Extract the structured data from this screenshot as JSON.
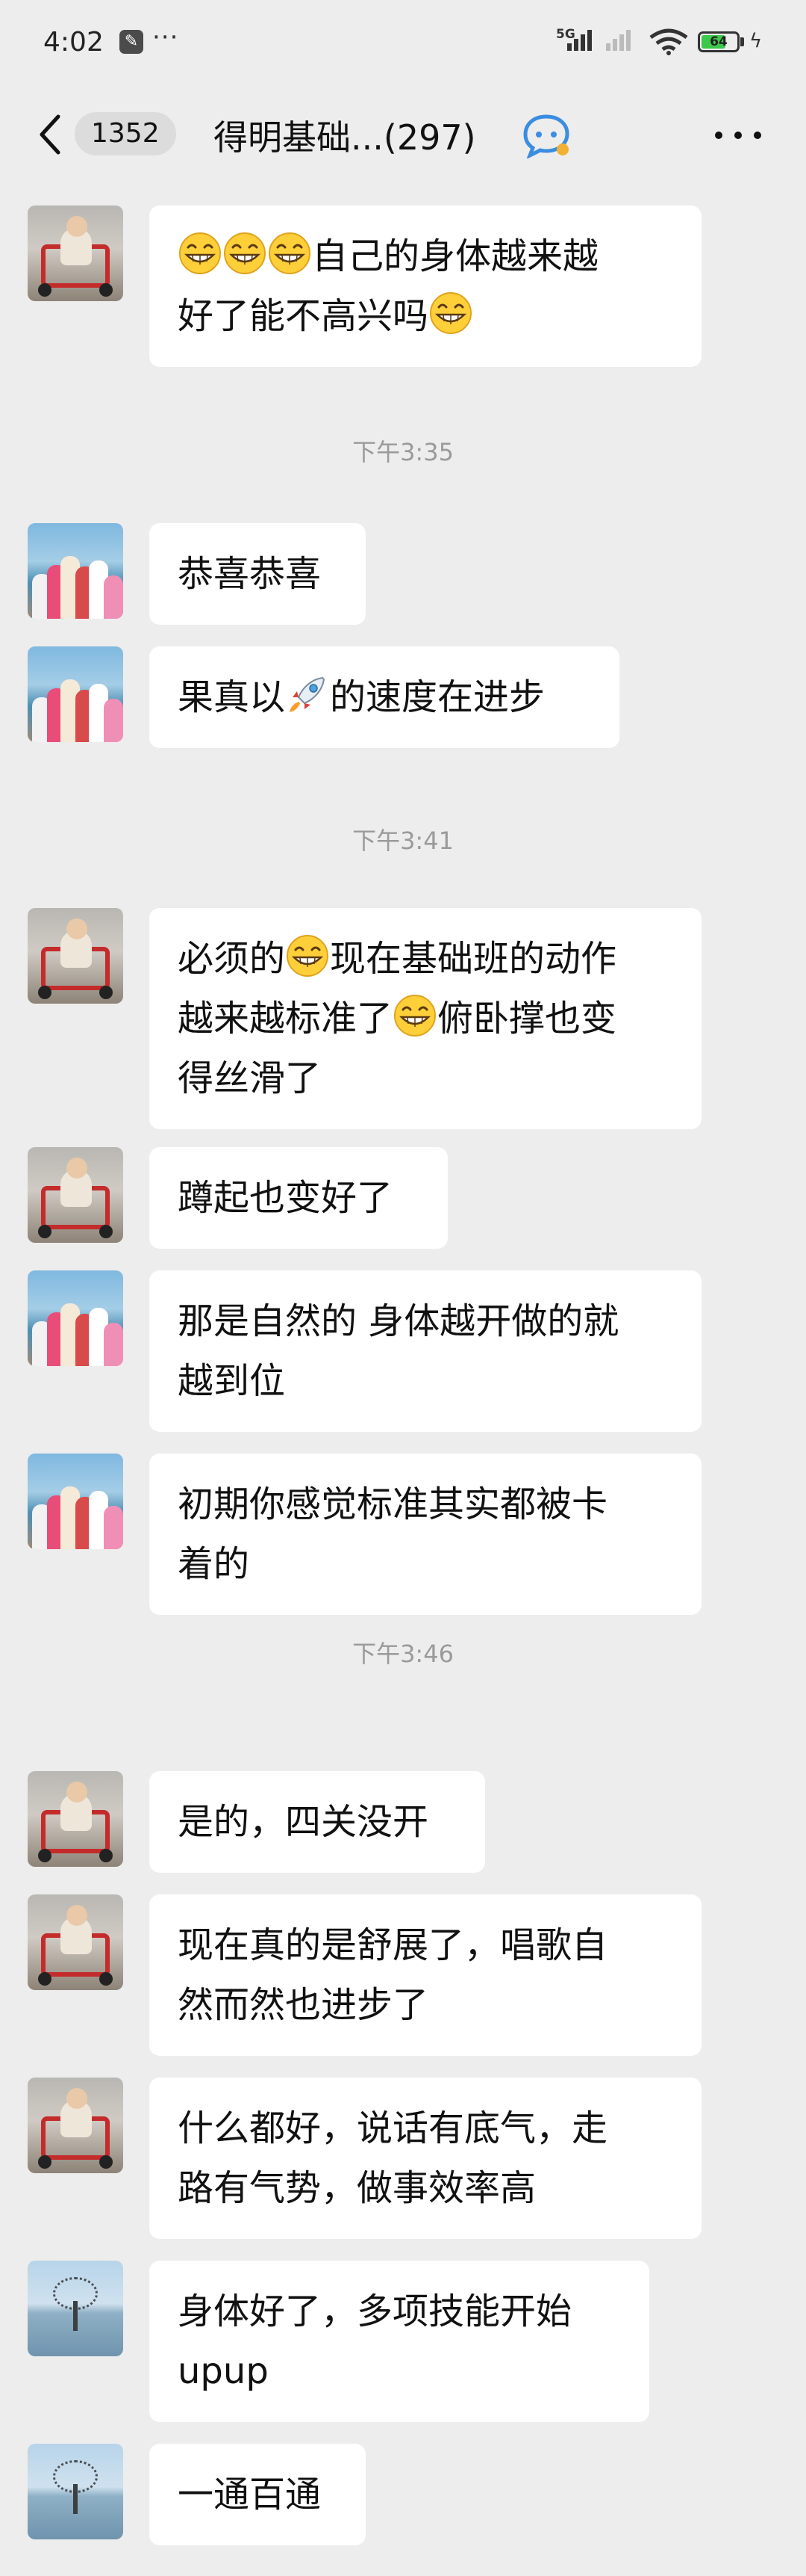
{
  "status_bar": {
    "time": "4:02",
    "more": "···",
    "network": "5G",
    "battery": "64"
  },
  "nav": {
    "unread_count": "1352",
    "title": "得明基础...(297)"
  },
  "messages": [
    {
      "type": "message",
      "sender": "baby",
      "parts": [
        "emoji:grin",
        "emoji:grin",
        "emoji:grin",
        "自己的身体越来越\n好了能不高兴吗",
        "emoji:grin"
      ]
    },
    {
      "type": "time",
      "text": "下午3:35"
    },
    {
      "type": "message",
      "sender": "group",
      "parts": [
        "恭喜恭喜"
      ]
    },
    {
      "type": "message",
      "sender": "group",
      "parts": [
        "果真以",
        "emoji:rocket",
        "的速度在进步"
      ]
    },
    {
      "type": "time",
      "text": "下午3:41"
    },
    {
      "type": "message",
      "sender": "baby",
      "parts": [
        "必须的",
        "emoji:grin",
        "现在基础班的动作\n越来越标准了",
        "emoji:grin",
        "俯卧撑也变\n得丝滑了"
      ]
    },
    {
      "type": "message",
      "sender": "baby",
      "parts": [
        "蹲起也变好了"
      ]
    },
    {
      "type": "message",
      "sender": "group",
      "parts": [
        "那是自然的 身体越开做的就\n越到位"
      ]
    },
    {
      "type": "message",
      "sender": "group",
      "parts": [
        "初期你感觉标准其实都被卡\n着的"
      ]
    },
    {
      "type": "time",
      "text": "下午3:46"
    },
    {
      "type": "message",
      "sender": "baby",
      "parts": [
        "是的，四关没开"
      ]
    },
    {
      "type": "message",
      "sender": "baby",
      "parts": [
        "现在真的是舒展了，唱歌自\n然而然也进步了"
      ]
    },
    {
      "type": "message",
      "sender": "baby",
      "parts": [
        "什么都好，说话有底气，走\n路有气势，做事效率高"
      ]
    },
    {
      "type": "message",
      "sender": "tree",
      "parts": [
        "身体好了，多项技能开始\nupup"
      ]
    },
    {
      "type": "message",
      "sender": "tree",
      "parts": [
        "一通百通"
      ]
    }
  ]
}
